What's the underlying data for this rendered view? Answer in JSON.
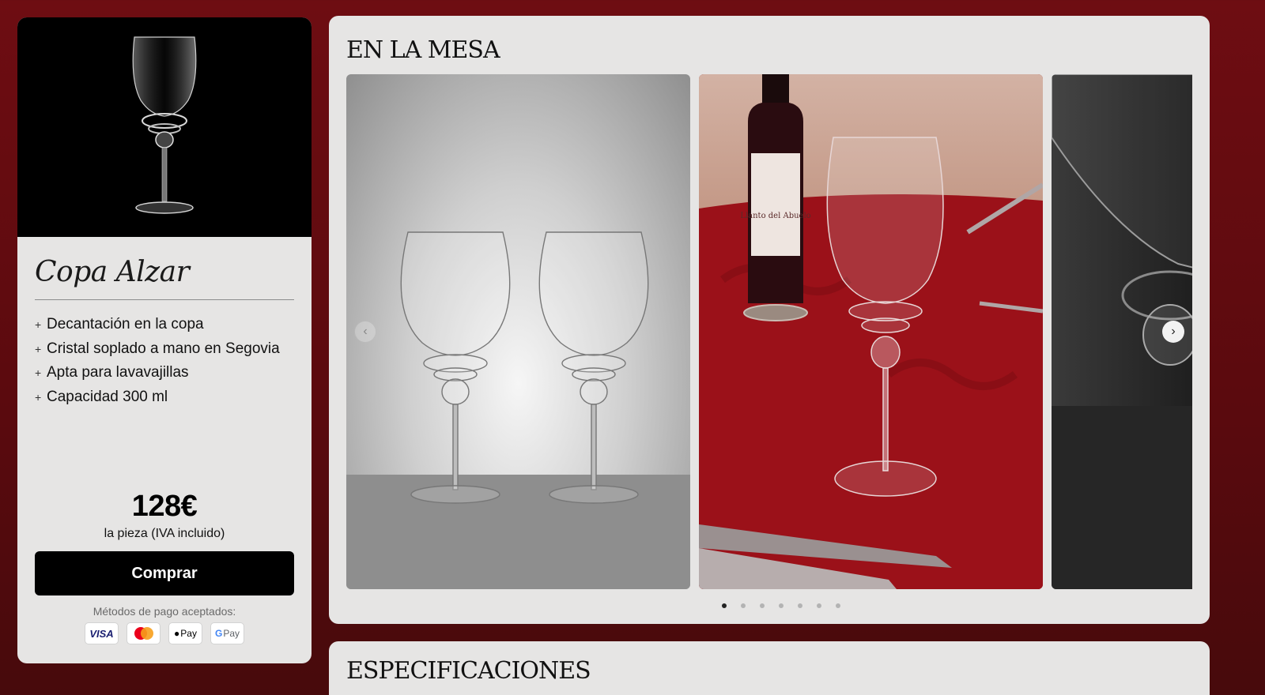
{
  "product": {
    "title": "Copa Alzar",
    "features": [
      "Decantación en la copa",
      "Cristal soplado a mano en Segovia",
      "Apta para lavavajillas",
      "Capacidad 300 ml"
    ],
    "feature_marker": "+",
    "price": "128€",
    "price_note": "la pieza (IVA incluido)",
    "buy_label": "Comprar",
    "payment_label": "Métodos de pago aceptados:",
    "payment_methods": [
      {
        "name": "visa-icon",
        "label": "VISA"
      },
      {
        "name": "mastercard-icon",
        "label": ""
      },
      {
        "name": "apple-pay-icon",
        "label": "Pay"
      },
      {
        "name": "google-pay-icon",
        "label": "Pay"
      }
    ]
  },
  "gallery": {
    "title": "EN LA MESA",
    "slide_count": 7,
    "active_slide": 1,
    "wine_label": "Llanto del Abuelo"
  },
  "specs": {
    "title": "ESPECIFICACIONES"
  },
  "colors": {
    "background": "#6e0d12",
    "card": "#e6e5e4",
    "button": "#000000"
  }
}
